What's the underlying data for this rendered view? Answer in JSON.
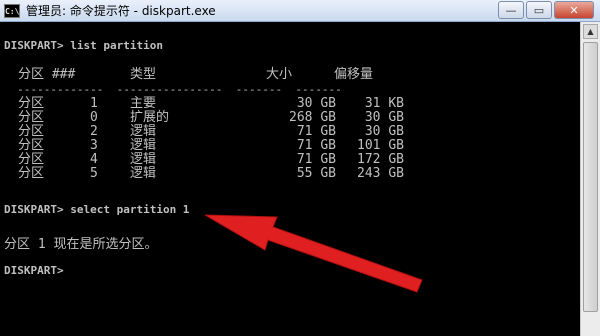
{
  "window": {
    "title": "管理员: 命令提示符 - diskpart.exe",
    "app_icon": "C:\\"
  },
  "controls": {
    "minimize": "—",
    "maximize": "▭",
    "close": "✕"
  },
  "console": {
    "cmd1": "DISKPART> list partition",
    "headers": [
      "分区 ###",
      "类型",
      "大小",
      "偏移量"
    ],
    "dashes": "  -------------  ----------------  -------  -------",
    "rows": [
      {
        "name": "分区",
        "num": "1",
        "type": "主要",
        "size": "30 GB",
        "offset": "31 KB"
      },
      {
        "name": "分区",
        "num": "0",
        "type": "扩展的",
        "size": "268 GB",
        "offset": "30 GB"
      },
      {
        "name": "分区",
        "num": "2",
        "type": "逻辑",
        "size": "71 GB",
        "offset": "30 GB"
      },
      {
        "name": "分区",
        "num": "3",
        "type": "逻辑",
        "size": "71 GB",
        "offset": "101 GB"
      },
      {
        "name": "分区",
        "num": "4",
        "type": "逻辑",
        "size": "71 GB",
        "offset": "172 GB"
      },
      {
        "name": "分区",
        "num": "5",
        "type": "逻辑",
        "size": "55 GB",
        "offset": "243 GB"
      }
    ],
    "cmd2": "DISKPART> select partition 1",
    "result": "分区 1 现在是所选分区。",
    "prompt": "DISKPART>"
  },
  "annotation": {
    "arrow_color": "#e02020",
    "icon": "arrow-icon"
  }
}
